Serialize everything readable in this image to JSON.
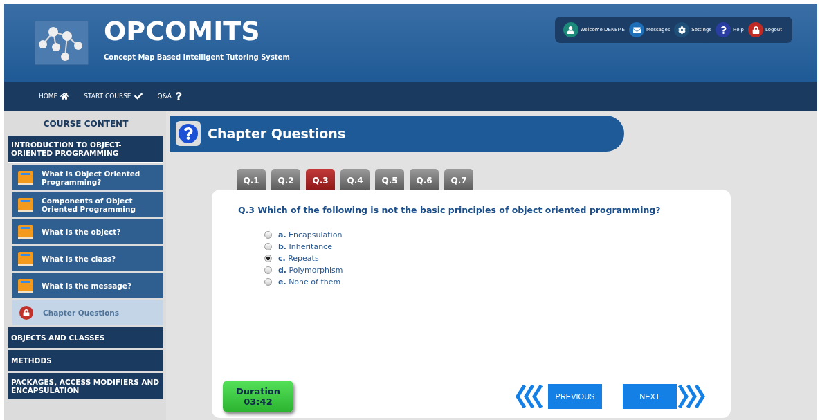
{
  "header": {
    "title": "OPCOMITS",
    "subtitle": "Concept Map Based Intelligent Tutoring System"
  },
  "user_bar": [
    {
      "kind": "user",
      "label": "Welcome DENEME"
    },
    {
      "kind": "messages",
      "label": "Messages"
    },
    {
      "kind": "settings",
      "label": "Settings"
    },
    {
      "kind": "help",
      "label": "Help"
    },
    {
      "kind": "logout",
      "label": "Logout"
    }
  ],
  "nav": [
    {
      "kind": "home",
      "label": "HOME"
    },
    {
      "kind": "check",
      "label": "START COURSE"
    },
    {
      "kind": "question",
      "label": "Q&A"
    }
  ],
  "sidebar": {
    "title": "COURSE CONTENT",
    "chapters": [
      {
        "label": "INTRODUCTION TO OBJECT-ORIENTED PROGRAMMING",
        "expanded": true,
        "children": [
          {
            "kind": "lesson",
            "label": "What is Object Oriented Programming?"
          },
          {
            "kind": "lesson",
            "label": "Components of Object Oriented Programming"
          },
          {
            "kind": "lesson",
            "label": "What is the object?"
          },
          {
            "kind": "lesson",
            "label": "What is the class?"
          },
          {
            "kind": "lesson",
            "label": "What is the message?"
          },
          {
            "kind": "locked",
            "label": "Chapter Questions"
          }
        ]
      },
      {
        "label": "OBJECTS AND CLASSES",
        "expanded": false
      },
      {
        "label": "METHODS",
        "expanded": false
      },
      {
        "label": "PACKAGES, ACCESS MODIFIERS AND ENCAPSULATION",
        "expanded": false
      }
    ]
  },
  "page_title": "Chapter Questions",
  "question_tabs": [
    {
      "label": "Q.1",
      "selected": false
    },
    {
      "label": "Q.2",
      "selected": false
    },
    {
      "label": "Q.3",
      "selected": true
    },
    {
      "label": "Q.4",
      "selected": false
    },
    {
      "label": "Q.5",
      "selected": false
    },
    {
      "label": "Q.6",
      "selected": false
    },
    {
      "label": "Q.7",
      "selected": false
    }
  ],
  "question": "Q.3 Which of the following is not the basic principles of object oriented programming?",
  "options": [
    {
      "letter": "a.",
      "label": "Encapsulation",
      "selected": false
    },
    {
      "letter": "b.",
      "label": "Inheritance",
      "selected": false
    },
    {
      "letter": "c.",
      "label": "Repeats",
      "selected": true
    },
    {
      "letter": "d.",
      "label": "Polymorphism",
      "selected": false
    },
    {
      "letter": "e.",
      "label": "None of them",
      "selected": false
    }
  ],
  "duration": {
    "label": "Duration",
    "value": "03:42"
  },
  "buttons": {
    "previous": "PREVIOUS",
    "next": "NEXT"
  }
}
